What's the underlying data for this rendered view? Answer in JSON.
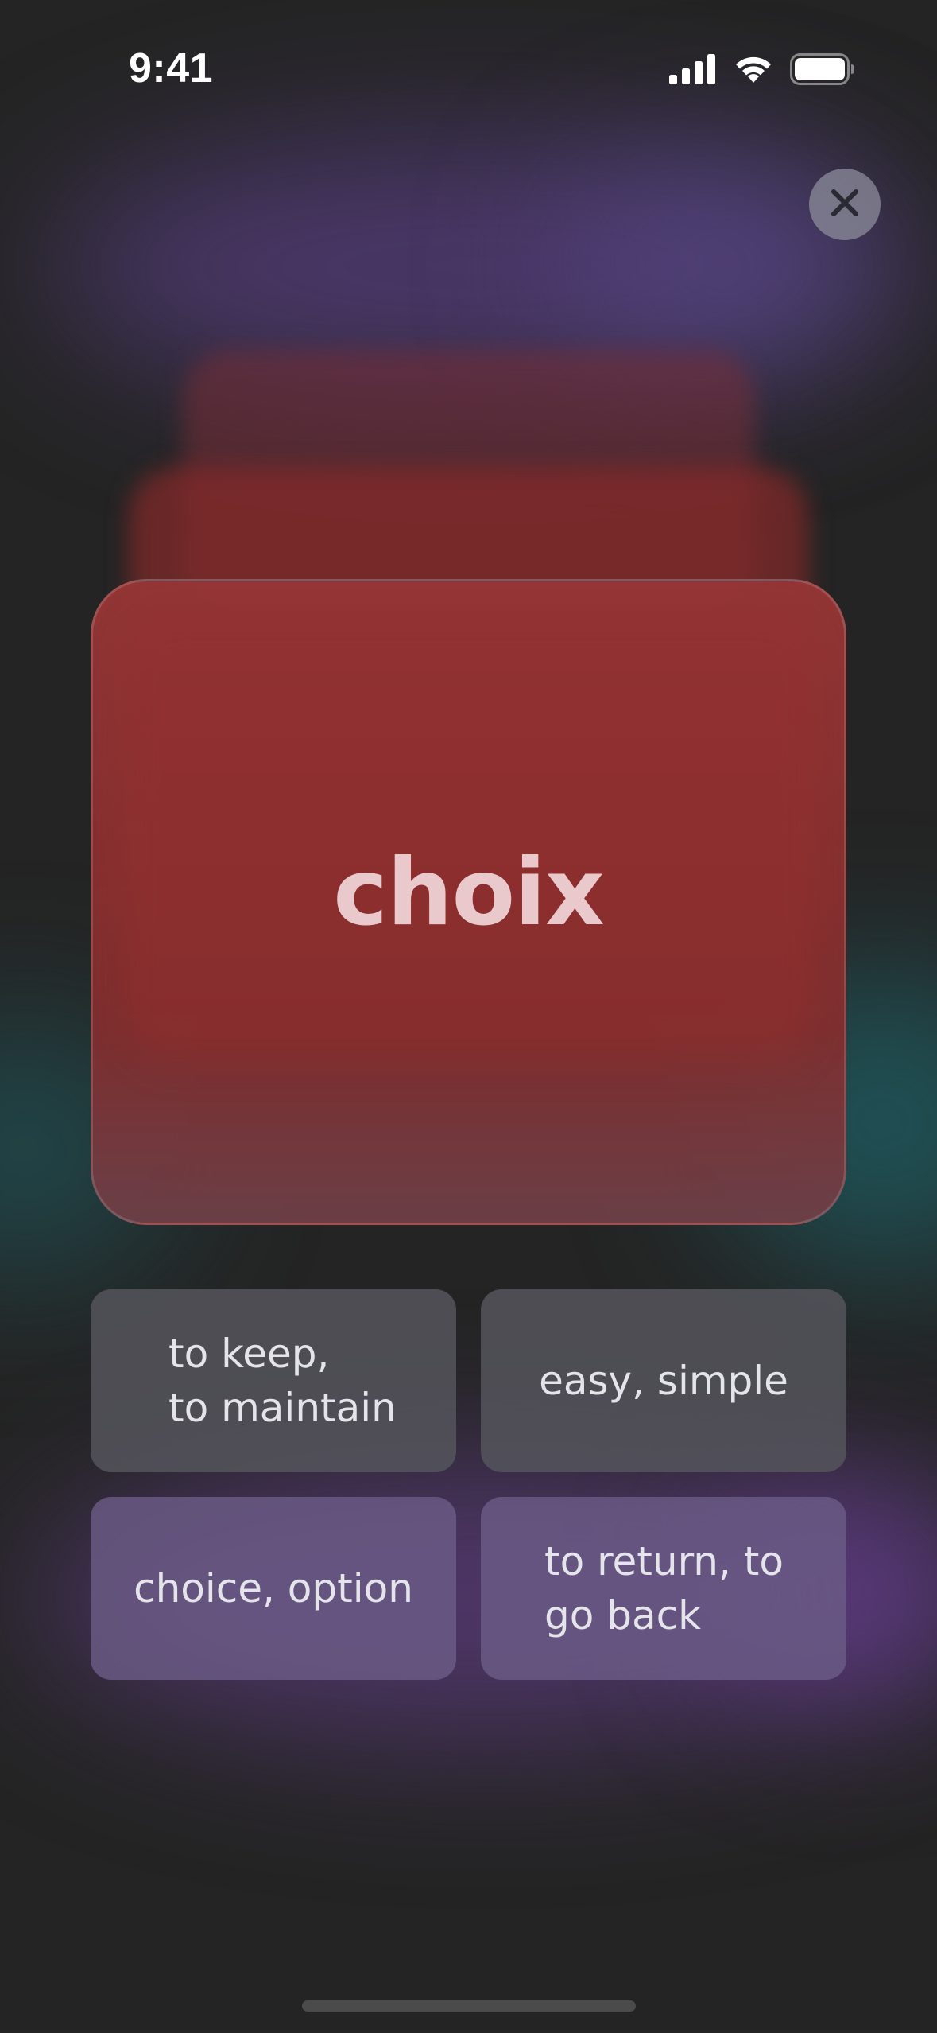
{
  "status_bar": {
    "time": "9:41",
    "icons": [
      "cellular-signal-icon",
      "wifi-icon",
      "battery-icon"
    ]
  },
  "close_button": {
    "icon": "close-icon"
  },
  "card": {
    "word": "choix",
    "color": "#963636"
  },
  "answers": [
    {
      "label": "to keep,\nto maintain"
    },
    {
      "label": "easy, simple"
    },
    {
      "label": "choice, option"
    },
    {
      "label": "to return, to\ngo back"
    }
  ],
  "colors": {
    "background": "#242424",
    "card_red": "#963636",
    "answer_gray": "#55555c",
    "answer_purple": "#6c5c87",
    "text_light": "#e4e4ea"
  }
}
